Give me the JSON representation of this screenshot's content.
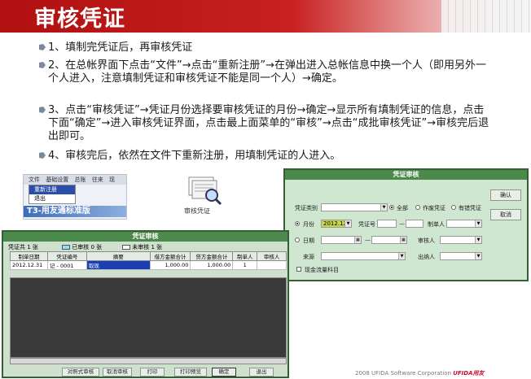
{
  "header": {
    "title": "审核凭证"
  },
  "steps": [
    "1、填制完凭证后，再审核凭证",
    "2、在总帐界面下点击“文件”→点击“重新注册”→在弹出进入总帐信息中换一个人（即用另外一个人进入，注意填制凭证和审核凭证不能是同一个人）→确定。",
    "3、点击“审核凭证”→凭证月份选择要审核凭证的月份→确定→显示所有填制凭证的信息，点击下面“确定”→进入审核凭证界面，点击最上面菜单的“审核”→点击“成批审核凭证”→审核完后退出即可。",
    "4、审核完后，依然在文件下重新注册，用填制凭证的人进入。"
  ],
  "menu_shot": {
    "menus": [
      "文件",
      "基础设置",
      "总账",
      "往来",
      "现"
    ],
    "dropdown": [
      "重新注册",
      "退出"
    ],
    "brand": "T3-用友通标准版"
  },
  "audit_icon": {
    "icon": "voucher-magnifier-icon",
    "label": "审核凭证"
  },
  "voucher_audit_dialog": {
    "title": "凭证审核",
    "voucher_type_label": "凭证类别",
    "all_label": "全部",
    "voided_label": "作废凭证",
    "error_label": "有错凭证",
    "month_label": "月份",
    "month_value": "2012.12",
    "voucher_no_label": "凭证号",
    "voucher_no_sep": "—",
    "maker_label": "制单人",
    "date_label": "日期",
    "date_sep": "—",
    "auditor_label": "审核人",
    "source_label": "来源",
    "cashier_label": "出纳人",
    "cashflow_label": "现金流量科目",
    "confirm_label": "确认",
    "cancel_label": "取消"
  },
  "voucher_list_dialog": {
    "title": "凭证审核",
    "total_label": "凭证共 1 张",
    "audited_label": "已审核 0 张",
    "unaudited_label": "未审核 1 张",
    "columns": [
      "制单日期",
      "凭证编号",
      "摘要",
      "借方金额合计",
      "贷方金额合计",
      "制单人",
      "审核人"
    ],
    "rows": [
      [
        "2012.12.31",
        "记 - 0001",
        "取现",
        "1,000.00",
        "1,000.00",
        "1",
        ""
      ]
    ],
    "buttons": [
      "对照式审核",
      "取消审核",
      "打印",
      "打印预览",
      "确定",
      "退出"
    ]
  },
  "footer": {
    "copyright": "2008 UFIDA Software Corporation",
    "brand": "UFIDA用友"
  },
  "colors": {
    "header_red": "#c82020",
    "dialog_green": "#4c8a4c",
    "highlight_blue": "#1a3fb5"
  }
}
